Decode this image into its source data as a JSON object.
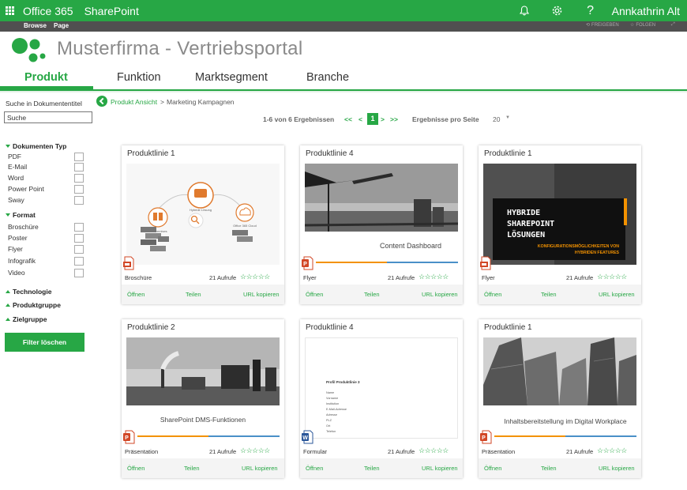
{
  "suite": {
    "brand": "Office 365",
    "app": "SharePoint",
    "user": "Annkathrin Alt"
  },
  "ribbon": {
    "tab_browse": "Browse",
    "tab_page": "Page",
    "share": "FREIGEBEN",
    "follow": "FOLGEN"
  },
  "site": {
    "title": "Musterfirma - Vertriebsportal"
  },
  "topnav": [
    {
      "label": "Produkt",
      "active": true
    },
    {
      "label": "Funktion"
    },
    {
      "label": "Marktsegment"
    },
    {
      "label": "Branche"
    }
  ],
  "sidebar": {
    "search_title": "Suche in Dokumententitel",
    "search_value": "Suche",
    "groups": [
      {
        "label": "Dokumenten Typ",
        "expanded": true,
        "items": [
          "PDF",
          "E-Mail",
          "Word",
          "Power Point",
          "Sway"
        ]
      },
      {
        "label": "Format",
        "expanded": true,
        "items": [
          "Broschüre",
          "Poster",
          "Flyer",
          "Infografik",
          "Video"
        ]
      },
      {
        "label": "Technologie",
        "expanded": false
      },
      {
        "label": "Produktgruppe",
        "expanded": false
      },
      {
        "label": "Zielgruppe",
        "expanded": false
      }
    ],
    "clear_button": "Filter löschen"
  },
  "breadcrumb": {
    "link": "Produkt Ansicht",
    "separator": ">",
    "current": "Marketing Kampagnen"
  },
  "pager": {
    "summary": "1-6 von 6 Ergebnissen",
    "first": "<<",
    "prev": "<",
    "current": "1",
    "next": ">",
    "last": ">>",
    "per_page_label": "Ergebnisse pro Seite",
    "per_page_value": "20"
  },
  "cards": [
    {
      "title": "Produktlinie 1",
      "type": "Broschüre",
      "views": "21 Aufrufe",
      "rating_stars": 5,
      "open": "Öffnen",
      "share": "Teilen",
      "copy": "URL kopieren",
      "file_icon": "pdf-icon",
      "thumb": {
        "kind": "diagram",
        "center_label": "Hybride Lösung",
        "left_label": "On-Premises",
        "right_label": "Office 365 Cloud"
      }
    },
    {
      "title": "Produktlinie 4",
      "type": "Flyer",
      "views": "21 Aufrufe",
      "rating_stars": 5,
      "open": "Öffnen",
      "share": "Teilen",
      "copy": "URL kopieren",
      "file_icon": "powerpoint-icon",
      "thumb": {
        "kind": "photo-caption",
        "caption": "Content Dashboard"
      }
    },
    {
      "title": "Produktlinie 1",
      "type": "Flyer",
      "views": "21 Aufrufe",
      "rating_stars": 5,
      "open": "Öffnen",
      "share": "Teilen",
      "copy": "URL kopieren",
      "file_icon": "pdf-icon",
      "thumb": {
        "kind": "poster",
        "line1": "HYBRIDE",
        "line2": "SHAREPOINT",
        "line3": "LÖSUNGEN",
        "sub1": "KONFIGURATIONSMÖGLICHKEITEN VON",
        "sub2": "HYBRIDEN FEATURES"
      }
    },
    {
      "title": "Produktlinie 2",
      "type": "Präsentation",
      "views": "21 Aufrufe",
      "rating_stars": 5,
      "open": "Öffnen",
      "share": "Teilen",
      "copy": "URL kopieren",
      "file_icon": "powerpoint-icon",
      "thumb": {
        "kind": "photo-caption",
        "caption": "SharePoint DMS-Funktionen"
      }
    },
    {
      "title": "Produktlinie 4",
      "type": "Formular",
      "views": "21 Aufrufe",
      "rating_stars": 5,
      "open": "Öffnen",
      "share": "Teilen",
      "copy": "URL kopieren",
      "file_icon": "word-icon",
      "thumb": {
        "kind": "form",
        "heading": "Profil Produktlinie 3",
        "fields": [
          "Name",
          "Vorname",
          "Institution",
          "E-Mail-Adresse",
          "Adresse",
          "PLZ",
          "Ort",
          "Telefon"
        ]
      }
    },
    {
      "title": "Produktlinie 1",
      "type": "Präsentation",
      "views": "21 Aufrufe",
      "rating_stars": 5,
      "open": "Öffnen",
      "share": "Teilen",
      "copy": "URL kopieren",
      "file_icon": "powerpoint-icon",
      "thumb": {
        "kind": "photo-caption",
        "caption": "Inhaltsbereitstellung im Digital Workplace"
      }
    }
  ],
  "colors": {
    "accent": "#27a745",
    "orange": "#f39200",
    "blue": "#4a90c8",
    "dark": "#1e1e1e"
  }
}
